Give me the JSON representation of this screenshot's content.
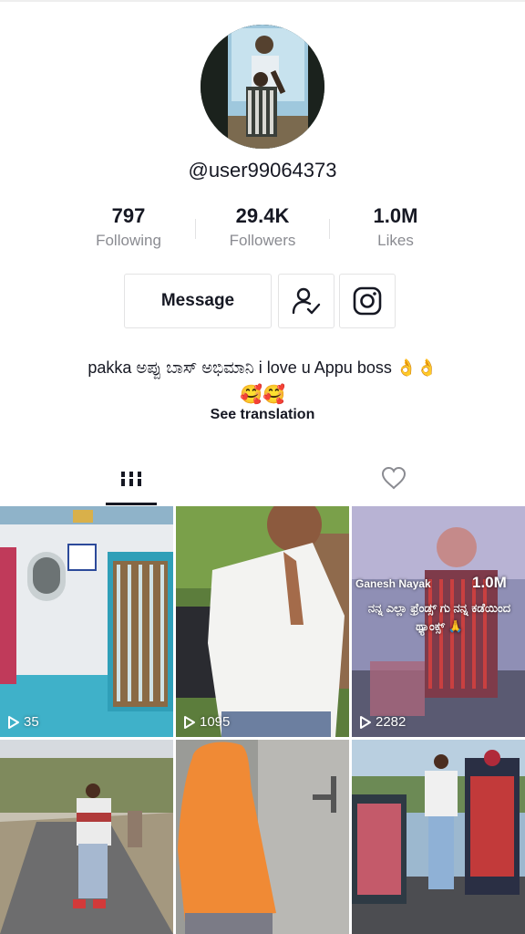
{
  "profile": {
    "username": "@user99064373",
    "stats": [
      {
        "value": "797",
        "label": "Following"
      },
      {
        "value": "29.4K",
        "label": "Followers"
      },
      {
        "value": "1.0M",
        "label": "Likes"
      }
    ],
    "message_button": "Message",
    "bio_line1": "pakka  ಅಪ್ಪು ಬಾಸ್ ಅಭಿಮಾನಿ i love u Appu boss 👌👌",
    "bio_line2": "🥰🥰",
    "see_translation": "See translation"
  },
  "tabs": [
    {
      "name": "videos",
      "icon": "grid-icon"
    },
    {
      "name": "liked",
      "icon": "heart-icon"
    }
  ],
  "videos": [
    {
      "views": "35"
    },
    {
      "views": "1095"
    },
    {
      "views": "2282",
      "overlay_name": "Ganesh Nayak",
      "overlay_count": "1.0M",
      "overlay_caption": "ನನ್ನ ಎಲ್ಲಾ ಫ್ರೆಂಡ್ಸ್ ಗು ನನ್ನ ಕಡೆಯಿಂದ ಥ್ಯಾಂಕ್ಸ್ 🙏"
    },
    {
      "views": ""
    },
    {
      "views": ""
    },
    {
      "views": ""
    }
  ],
  "colors": {
    "text_primary": "#161823",
    "text_secondary": "#8a8b91",
    "border": "#e3e3e4"
  }
}
